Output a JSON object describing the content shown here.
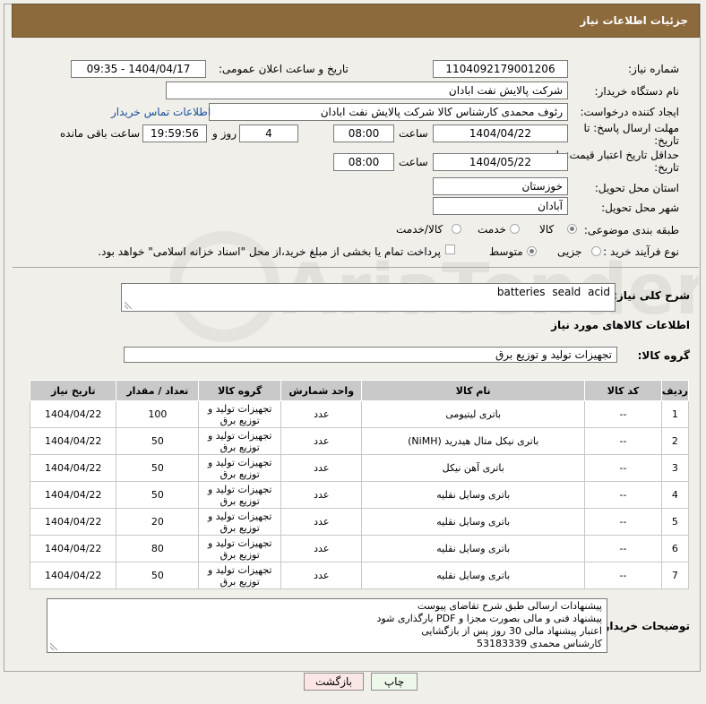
{
  "title": "جزئیات اطلاعات نیاز",
  "fields": {
    "need_number_label": "شماره نیاز:",
    "need_number": "1104092179001206",
    "announce_label": "تاریخ و ساعت اعلان عمومی:",
    "announce_value": "1404/04/17 - 09:35",
    "buyer_org_label": "نام دستگاه خریدار:",
    "buyer_org": "شرکت پالایش نفت ابادان",
    "creator_label": "ایجاد کننده درخواست:",
    "creator": "رئوف محمدی کارشناس کالا شرکت پالایش نفت ابادان",
    "contact_link": "اطلاعات تماس خریدار",
    "reply_deadline_label": "مهلت ارسال پاسخ: تا تاریخ:",
    "reply_date": "1404/04/22",
    "time_label": "ساعت",
    "reply_time": "08:00",
    "days_value": "4",
    "days_label": "روز و",
    "remaining_time": "19:59:56",
    "remaining_label": "ساعت باقی مانده",
    "price_validity_label": "حداقل تاریخ اعتبار قیمت: تا تاریخ:",
    "price_date": "1404/05/22",
    "price_time": "08:00",
    "province_label": "استان محل تحویل:",
    "province": "خوزستان",
    "city_label": "شهر محل تحویل:",
    "city": "آبادان",
    "category_label": "طبقه بندی موضوعی:",
    "category_options": [
      "کالا",
      "خدمت",
      "کالا/خدمت"
    ],
    "purchase_type_label": "نوع فرآیند خرید :",
    "purchase_options": [
      "جزیی",
      "متوسط"
    ],
    "payment_note": "پرداخت تمام یا بخشی از مبلغ خرید،از محل \"اسناد خزانه اسلامی\" خواهد بود."
  },
  "description": {
    "label": "شرح کلی نیاز:",
    "value": "batteries seald acid"
  },
  "goods_section_title": "اطلاعات کالاهای مورد نیاز",
  "goods_group": {
    "label": "گروه کالا:",
    "value": "تجهیزات تولید و توزیع برق"
  },
  "table": {
    "headers": [
      "ردیف",
      "کد کالا",
      "نام کالا",
      "واحد شمارش",
      "گروه کالا",
      "تعداد / مقدار",
      "تاریخ نیاز"
    ],
    "rows": [
      [
        "1",
        "--",
        "باتری لیتیومی",
        "عدد",
        "تجهیزات تولید و توزیع برق",
        "100",
        "1404/04/22"
      ],
      [
        "2",
        "--",
        "باتری نیکل متال هیدرید (NiMH)",
        "عدد",
        "تجهیزات تولید و توزیع برق",
        "50",
        "1404/04/22"
      ],
      [
        "3",
        "--",
        "باتری آهن نیکل",
        "عدد",
        "تجهیزات تولید و توزیع برق",
        "50",
        "1404/04/22"
      ],
      [
        "4",
        "--",
        "باتری وسایل نقلیه",
        "عدد",
        "تجهیزات تولید و توزیع برق",
        "50",
        "1404/04/22"
      ],
      [
        "5",
        "--",
        "باتری وسایل نقلیه",
        "عدد",
        "تجهیزات تولید و توزیع برق",
        "20",
        "1404/04/22"
      ],
      [
        "6",
        "--",
        "باتری وسایل نقلیه",
        "عدد",
        "تجهیزات تولید و توزیع برق",
        "80",
        "1404/04/22"
      ],
      [
        "7",
        "--",
        "باتری وسایل نقلیه",
        "عدد",
        "تجهیزات تولید و توزیع برق",
        "50",
        "1404/04/22"
      ]
    ]
  },
  "buyer_notes": {
    "label": "توضیحات خریدار:",
    "lines": [
      "پیشنهادات ارسالی طبق شرح تقاضای پیوست",
      "پیشنهاد فنی و مالی بصورت مجزا و PDF بارگذاری شود",
      "اعتبار پیشنهاد مالی 30 روز پس از بازگشایی",
      "کارشناس محمدی 53183339"
    ]
  },
  "buttons": {
    "print": "چاپ",
    "back": "بازگشت"
  },
  "watermark_text": "AriaTender.net"
}
